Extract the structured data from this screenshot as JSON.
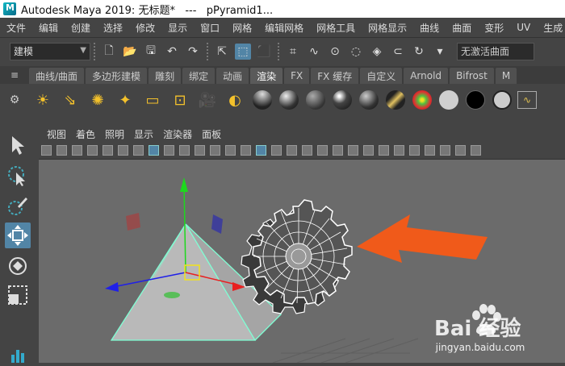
{
  "titlebar": {
    "title": "Autodesk Maya 2019: 无标题*   ---   pPyramid1..."
  },
  "menubar": {
    "items": [
      "文件",
      "编辑",
      "创建",
      "选择",
      "修改",
      "显示",
      "窗口",
      "网格",
      "编辑网格",
      "网格工具",
      "网格显示",
      "曲线",
      "曲面",
      "变形",
      "UV",
      "生成"
    ]
  },
  "statusline": {
    "mode": "建模",
    "object_field": "无激活曲面"
  },
  "shelf": {
    "tabs": [
      "曲线/曲面",
      "多边形建模",
      "雕刻",
      "绑定",
      "动画",
      "渲染",
      "FX",
      "FX 缓存",
      "自定义",
      "Arnold",
      "Bifrost",
      "M"
    ],
    "active_tab": "渲染"
  },
  "panel": {
    "menu": [
      "视图",
      "着色",
      "照明",
      "显示",
      "渲染器",
      "面板"
    ]
  },
  "watermark": {
    "brand": "Bai 经验",
    "url": "jingyan.baidu.com"
  },
  "colors": {
    "ui_bg": "#444444",
    "viewport_bg": "#6b6b6b",
    "accent": "#5285a6",
    "arrow": "#f05a1a",
    "pyramid_edge": "#7fffd4"
  }
}
